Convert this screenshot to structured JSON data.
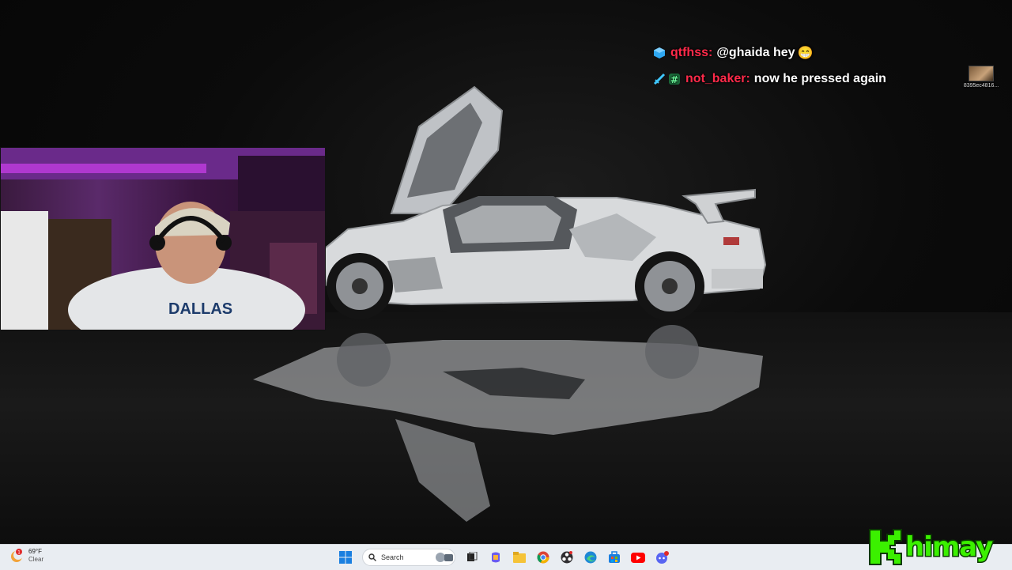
{
  "chat": {
    "messages": [
      {
        "username": "qtfhss",
        "separator": ":",
        "text": "@ghaida hey",
        "emoji": "😁",
        "name_color": "#ff2a4a"
      },
      {
        "username": "not_baker",
        "separator": ":",
        "text": "now he pressed again",
        "emoji": "",
        "name_color": "#ff2a4a"
      }
    ]
  },
  "desktop": {
    "file_label": "8395ec4816..."
  },
  "taskbar": {
    "weather": {
      "temp": "69°F",
      "condition": "Clear",
      "alert_count": "1"
    },
    "search_placeholder": "Search",
    "apps": [
      "windows-start",
      "search",
      "copilot-widget",
      "task-view",
      "copilot",
      "file-explorer",
      "chrome",
      "obs",
      "edge",
      "microsoft-store",
      "youtube",
      "discord"
    ]
  },
  "overlay": {
    "brand_text": "himay",
    "brand_color": "#3bf000"
  }
}
